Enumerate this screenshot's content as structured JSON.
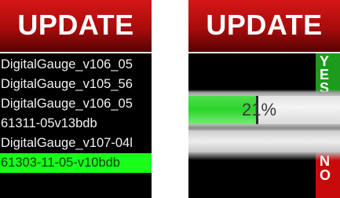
{
  "left_screen": {
    "header": {
      "title": "UPDATE"
    },
    "file_list": {
      "items": [
        {
          "label": "DigitalGauge_v106_05",
          "selected": false
        },
        {
          "label": "DigitalGauge_v105_56",
          "selected": false
        },
        {
          "label": "DigitalGauge_v106_05",
          "selected": false
        },
        {
          "label": "61311-05v13bdb",
          "selected": false
        },
        {
          "label": "DigitalGauge_v107-04l",
          "selected": false
        },
        {
          "label": "61303-11-05-v10bdb",
          "selected": true
        }
      ]
    }
  },
  "right_screen": {
    "header": {
      "title": "UPDATE"
    },
    "confirm": {
      "yes_label": "YES",
      "no_label": "NO"
    },
    "progress": {
      "value_percent": 21,
      "text": "21%"
    }
  },
  "colors": {
    "header_red": "#c81212",
    "selected_green": "#19ff19",
    "yes_green": "#1d9b1d",
    "no_red": "#c80a0a",
    "progress_green": "#2ad42a"
  }
}
